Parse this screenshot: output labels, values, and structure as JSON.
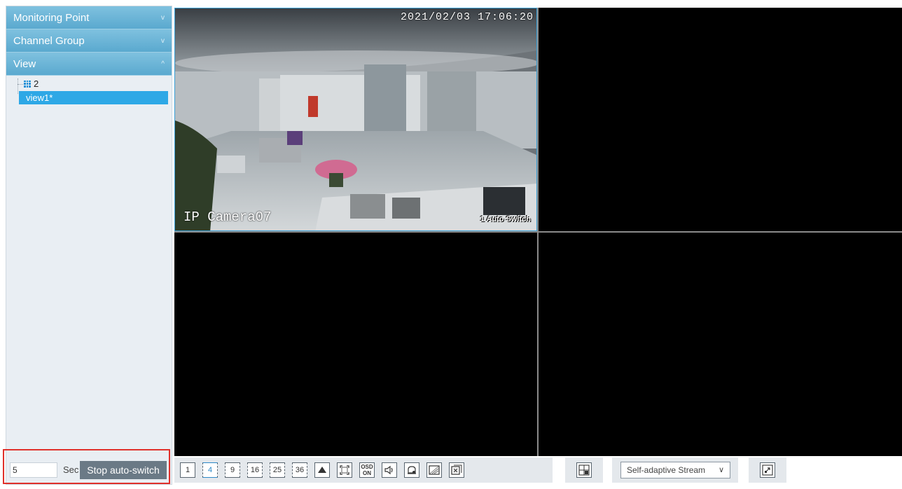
{
  "sidebar": {
    "sections": [
      {
        "label": "Monitoring Point",
        "chevron": "v"
      },
      {
        "label": "Channel Group",
        "chevron": "v"
      },
      {
        "label": "View",
        "chevron": "^"
      }
    ],
    "tree": {
      "group_label": "2",
      "selected_item": "view1*"
    }
  },
  "auto_switch": {
    "interval_value": "5",
    "unit": "Sec",
    "button_label": "Stop auto-switch"
  },
  "video": {
    "panes": [
      {
        "timestamp": "2021/02/03 17:06:20",
        "camera_name": "IP Camera07",
        "badge": "1 Auto Switch"
      }
    ]
  },
  "toolbar": {
    "layout_buttons": [
      "1",
      "4",
      "9",
      "16",
      "25",
      "36"
    ],
    "osd_top": "OSD",
    "osd_bottom": "ON",
    "stream_value": "Self-adaptive Stream",
    "stream_arrow": "∨"
  },
  "colors": {
    "accent": "#2ea8e6",
    "header_blue": "#5aa9cf",
    "stop_button": "#6b7a86",
    "highlight_red": "#e0312b"
  }
}
